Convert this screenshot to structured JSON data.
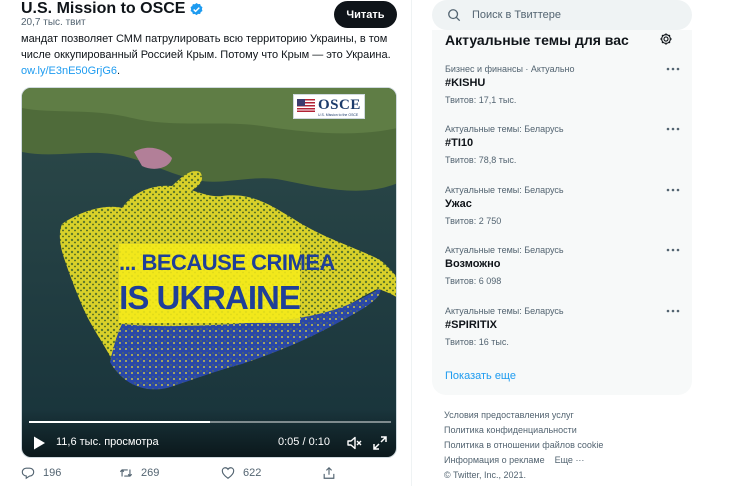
{
  "header": {
    "account_name": "U.S. Mission to OSCE",
    "tweet_count": "20,7 тыс. твит",
    "read_button": "Читать"
  },
  "tweet": {
    "text_line1": "мандат позволяет СММ патрулировать всю территорию Украины, в том",
    "text_line2": "числе оккупированный Россией Крым. Потому что Крым — это Украина.",
    "link": "ow.ly/E3nE50GrjG6",
    "link_suffix": "."
  },
  "media": {
    "logo_text": "OSCE",
    "logo_subtext": "U.S. Mission to the OSCE",
    "banner_line1": "... BECAUSE CRIMEA",
    "banner_line2": "IS UKRAINE",
    "views": "11,6 тыс. просмотра",
    "time": "0:05 / 0:10",
    "progress": 0.5,
    "flag_colors": {
      "yellow": "#f5eb19",
      "blue": "#1f3f98"
    }
  },
  "actions": {
    "replies": "196",
    "retweets": "269",
    "likes": "622"
  },
  "search": {
    "placeholder": "Поиск в Твиттере"
  },
  "trends": {
    "title": "Актуальные темы для вас",
    "items": [
      {
        "meta": "Бизнес и финансы · Актуально",
        "name": "#KISHU",
        "count": "Твитов: 17,1 тыс."
      },
      {
        "meta": "Актуальные темы: Беларусь",
        "name": "#TI10",
        "count": "Твитов: 78,8 тыс."
      },
      {
        "meta": "Актуальные темы: Беларусь",
        "name": "Ужас",
        "count": "Твитов: 2 750"
      },
      {
        "meta": "Актуальные темы: Беларусь",
        "name": "Возможно",
        "count": "Твитов: 6 098"
      },
      {
        "meta": "Актуальные темы: Беларусь",
        "name": "#SPIRITIX",
        "count": "Твитов: 16 тыс."
      }
    ],
    "show_more": "Показать еще"
  },
  "footer": {
    "links": [
      "Условия предоставления услуг",
      "Политика конфиденциальности",
      "Политика в отношении файлов cookie",
      "Информация о рекламе",
      "Еще ···"
    ],
    "copyright": "© Twitter, Inc., 2021."
  },
  "colors": {
    "accent": "#1d9bf0",
    "text": "#0f1419",
    "secondary": "#536471"
  }
}
